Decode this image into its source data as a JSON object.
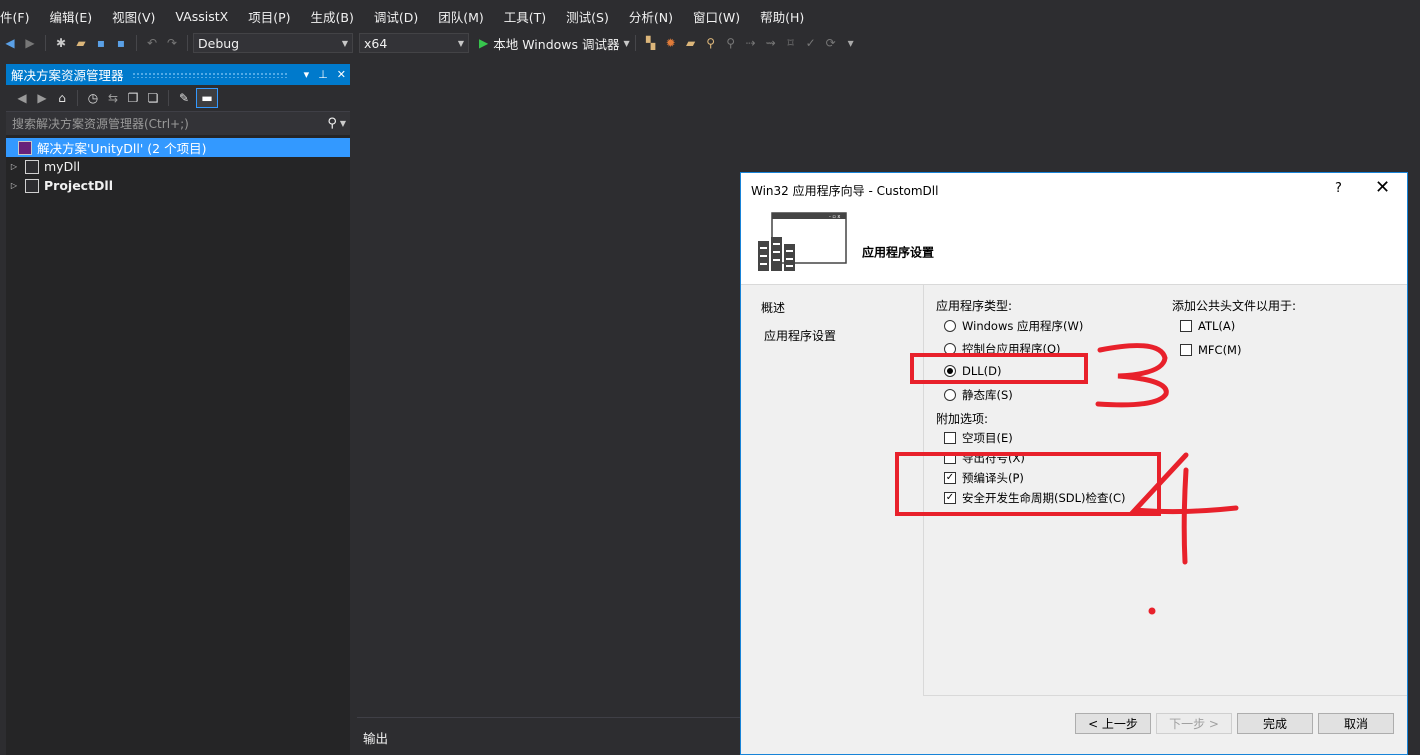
{
  "menubar": {
    "items": [
      "件(F)",
      "编辑(E)",
      "视图(V)",
      "VAssistX",
      "项目(P)",
      "生成(B)",
      "调试(D)",
      "团队(M)",
      "工具(T)",
      "测试(S)",
      "分析(N)",
      "窗口(W)",
      "帮助(H)"
    ]
  },
  "toolbar": {
    "config": "Debug",
    "platform": "x64",
    "run_label": "本地 Windows 调试器"
  },
  "solution_explorer": {
    "title": "解决方案资源管理器",
    "search_placeholder": "搜索解决方案资源管理器(Ctrl+;)",
    "solution": "解决方案'UnityDll' (2 个项目)",
    "projects": [
      "myDll",
      "ProjectDll"
    ]
  },
  "output": {
    "title": "输出"
  },
  "dialog": {
    "title": "Win32 应用程序向导 - CustomDll",
    "help": "?",
    "close": "✕",
    "heading": "应用程序设置",
    "nav": [
      "概述",
      "应用程序设置"
    ],
    "app_type_label": "应用程序类型:",
    "app_types": [
      {
        "label": "Windows 应用程序(W)",
        "selected": false
      },
      {
        "label": "控制台应用程序(O)",
        "selected": false
      },
      {
        "label": "DLL(D)",
        "selected": true
      },
      {
        "label": "静态库(S)",
        "selected": false
      }
    ],
    "extra_label": "附加选项:",
    "extra_options": [
      {
        "label": "空项目(E)",
        "checked": false
      },
      {
        "label": "导出符号(X)",
        "checked": false
      },
      {
        "label": "预编译头(P)",
        "checked": true
      },
      {
        "label": "安全开发生命周期(SDL)检查(C)",
        "checked": true
      }
    ],
    "headers_label": "添加公共头文件以用于:",
    "header_options": [
      {
        "label": "ATL(A)",
        "checked": false
      },
      {
        "label": "MFC(M)",
        "checked": false
      }
    ],
    "buttons": {
      "prev": "< 上一步",
      "next": "下一步 >",
      "finish": "完成",
      "cancel": "取消"
    }
  },
  "annotations": {
    "color": "#e8212b",
    "mark_3": "3",
    "mark_4": "4"
  }
}
